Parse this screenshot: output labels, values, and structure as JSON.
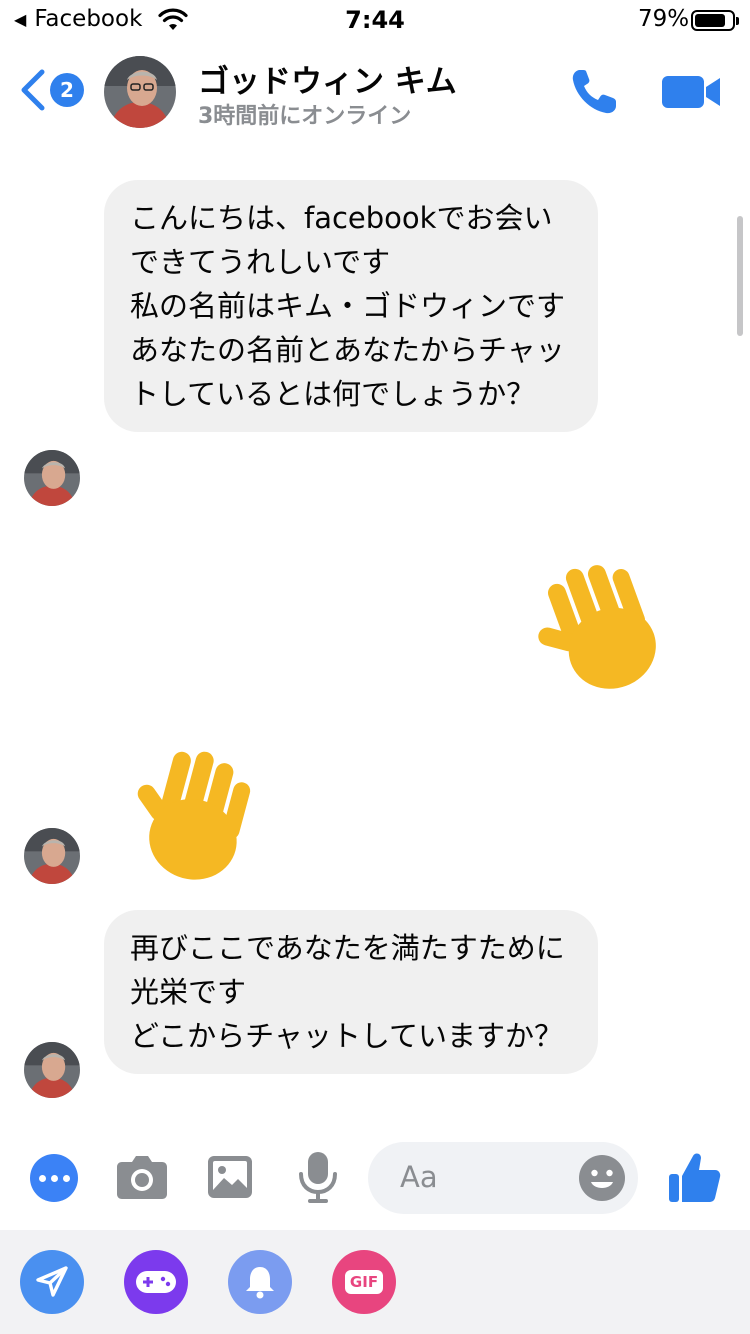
{
  "status_bar": {
    "back_app": "Facebook",
    "time": "7:44",
    "battery": "79%"
  },
  "header": {
    "back_count": "2",
    "contact_name": "ゴッドウィン キム",
    "contact_status": "3時間前にオンライン"
  },
  "messages": [
    {
      "sender": "contact",
      "type": "text",
      "text": "こんにちは、facebookでお会いできてうれしいです\n私の名前はキム・ゴドウィンです\nあなたの名前とあなたからチャットしているとは何でしょうか？"
    },
    {
      "sender": "me",
      "type": "emoji",
      "emoji": "waving-hand"
    },
    {
      "sender": "contact",
      "type": "emoji",
      "emoji": "waving-hand"
    },
    {
      "sender": "contact",
      "type": "text",
      "text": "再びここであなたを満たすために光栄です\nどこからチャットしていますか？"
    }
  ],
  "composer": {
    "placeholder": "Aa",
    "icons": [
      "more-icon",
      "camera-icon",
      "gallery-icon",
      "microphone-icon",
      "emoji-icon",
      "thumbs-up-icon"
    ]
  },
  "apps_bar": {
    "icons": [
      "send-icon",
      "games-icon",
      "bell-icon",
      "gif-icon"
    ],
    "gif_label": "GIF"
  },
  "colors": {
    "accent": "#2f80ed",
    "bubble": "#f0f0f0",
    "games": "#7c3aed",
    "gif": "#e8457f"
  }
}
